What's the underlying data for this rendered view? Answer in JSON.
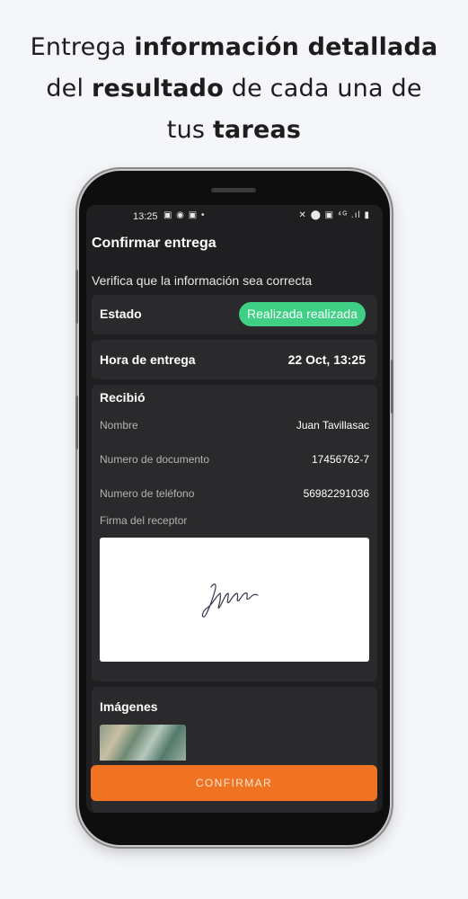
{
  "headline": {
    "line1_a": "Entrega ",
    "line1_b": "información detallada",
    "line2_a": "del ",
    "line2_b": "resultado",
    "line2_c": " de cada una de",
    "line3_a": "tus ",
    "line3_b": "tareas"
  },
  "statusbar": {
    "time": "13:25",
    "left_icons": "▣ ◉ ▣ •",
    "right_icons": "✕ ⬤ ▣ ⁴ᴳ .ıl ▮"
  },
  "screen": {
    "title": "Confirmar entrega",
    "subtitle": "Verifica que la información sea correcta"
  },
  "estado": {
    "label": "Estado",
    "badge": "Realizada realizada",
    "badge_color": "#3fcf85"
  },
  "hora": {
    "label": "Hora de entrega",
    "value": "22 Oct, 13:25"
  },
  "recibio": {
    "title": "Recibió",
    "rows": [
      {
        "key": "Nombre",
        "value": "Juan Tavillasac"
      },
      {
        "key": "Numero de documento",
        "value": "17456762-7"
      },
      {
        "key": "Numero de teléfono",
        "value": "56982291036"
      }
    ],
    "firma_label": "Firma del receptor"
  },
  "imagenes": {
    "title": "Imágenes"
  },
  "confirm_button": {
    "label": "CONFIRMAR",
    "color": "#f07321"
  }
}
